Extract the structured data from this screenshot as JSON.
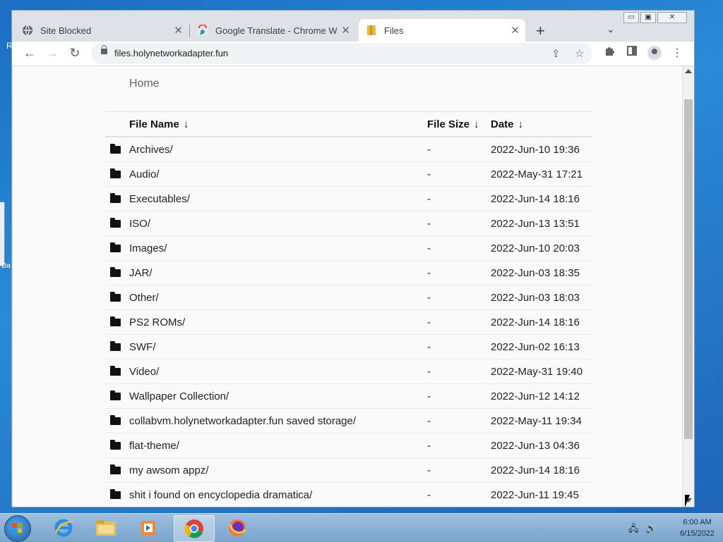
{
  "browser": {
    "tabs": [
      {
        "title": "Site Blocked",
        "icon": "globe-icon",
        "active": false
      },
      {
        "title": "Google Translate - Chrome Web",
        "icon": "chrome-web-store-icon",
        "active": false
      },
      {
        "title": "Files",
        "icon": "files-icon",
        "active": true
      }
    ],
    "url": "files.holynetworkadapter.fun"
  },
  "page": {
    "breadcrumb": "Home",
    "columns": {
      "name": "File Name",
      "size": "File Size",
      "date": "Date",
      "sort_arrow": "↓"
    },
    "rows": [
      {
        "name": "Archives/",
        "size": "-",
        "date": "2022-Jun-10 19:36"
      },
      {
        "name": "Audio/",
        "size": "-",
        "date": "2022-May-31 17:21"
      },
      {
        "name": "Executables/",
        "size": "-",
        "date": "2022-Jun-14 18:16"
      },
      {
        "name": "ISO/",
        "size": "-",
        "date": "2022-Jun-13 13:51"
      },
      {
        "name": "Images/",
        "size": "-",
        "date": "2022-Jun-10 20:03"
      },
      {
        "name": "JAR/",
        "size": "-",
        "date": "2022-Jun-03 18:35"
      },
      {
        "name": "Other/",
        "size": "-",
        "date": "2022-Jun-03 18:03"
      },
      {
        "name": "PS2 ROMs/",
        "size": "-",
        "date": "2022-Jun-14 18:16"
      },
      {
        "name": "SWF/",
        "size": "-",
        "date": "2022-Jun-02 16:13"
      },
      {
        "name": "Video/",
        "size": "-",
        "date": "2022-May-31 19:40"
      },
      {
        "name": "Wallpaper Collection/",
        "size": "-",
        "date": "2022-Jun-12 14:12"
      },
      {
        "name": "collabvm.holynetworkadapter.fun saved storage/",
        "size": "-",
        "date": "2022-May-11 19:34"
      },
      {
        "name": "flat-theme/",
        "size": "-",
        "date": "2022-Jun-13 04:36"
      },
      {
        "name": "my awsom appz/",
        "size": "-",
        "date": "2022-Jun-14 18:16"
      },
      {
        "name": "shit i found on encyclopedia dramatica/",
        "size": "-",
        "date": "2022-Jun-11 19:45"
      }
    ]
  },
  "taskbar": {
    "time": "6:00 AM",
    "date": "6/15/2022"
  },
  "colors": {
    "desktop": "#1b6ec2",
    "tab_strip": "#dee1e6",
    "page_bg": "#fafafa"
  }
}
